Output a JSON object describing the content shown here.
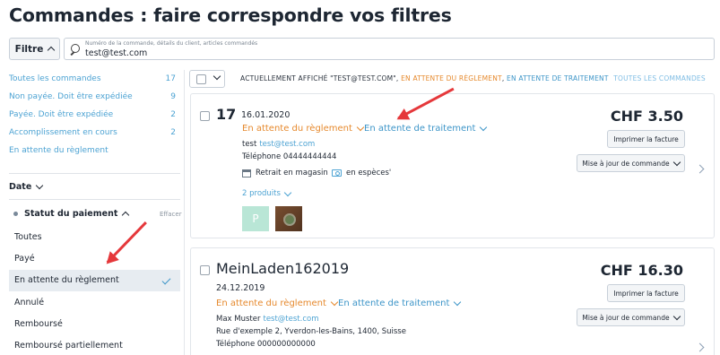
{
  "page": {
    "title": "Commandes : faire correspondre vos filtres"
  },
  "toolbar": {
    "filter_label": "Filtre",
    "search_placeholder": "Numéro de la commande, détails du client, articles commandés",
    "search_value": "test@test.com"
  },
  "sidebar": {
    "items": [
      {
        "label": "Toutes les commandes",
        "count": "17"
      },
      {
        "label": "Non payée. Doit être expédiée",
        "count": "9"
      },
      {
        "label": "Payée. Doit être expédiée",
        "count": "2"
      },
      {
        "label": "Accomplissement en cours",
        "count": "2"
      },
      {
        "label": "En attente du règlement",
        "count": ""
      }
    ],
    "date_label": "Date",
    "payment_status": {
      "label": "Statut du paiement",
      "clear_label": "Effacer",
      "options": [
        {
          "label": "Toutes",
          "selected": false
        },
        {
          "label": "Payé",
          "selected": false
        },
        {
          "label": "En attente du règlement",
          "selected": true
        },
        {
          "label": "Annulé",
          "selected": false
        },
        {
          "label": "Remboursé",
          "selected": false
        },
        {
          "label": "Remboursé partiellement",
          "selected": false
        }
      ]
    }
  },
  "filters_bar": {
    "prefix": "ACTUELLEMENT AFFICHÉ \"TEST@TEST.COM\",",
    "payment": "EN ATTENTE DU RÈGLEMENT",
    "comma": ",",
    "processing": "EN ATTENTE DE TRAITEMENT",
    "all_orders": "TOUTES LES COMMANDES"
  },
  "orders": [
    {
      "number": "17",
      "date": "16.01.2020",
      "payment_status": "En attente du règlement",
      "processing_status": "En attente de traitement",
      "customer_name": "test",
      "customer_email": "test@test.com",
      "phone": "Téléphone 04444444444",
      "shipping": "Retrait en magasin",
      "payment_method": "en espèces'",
      "products_link": "2 produits",
      "thumb_letter": "P",
      "price": "CHF 3.50",
      "print_label": "Imprimer la facture",
      "update_label": "Mise à jour de commande"
    },
    {
      "number": "MeinLaden162019",
      "date": "24.12.2019",
      "payment_status": "En attente du règlement",
      "processing_status": "En attente de traitement",
      "customer_name": "Max Muster",
      "customer_email": "test@test.com",
      "address": "Rue d'exemple 2, Yverdon-les-Bains, 1400, Suisse",
      "phone": "Téléphone 000000000000",
      "price": "CHF 16.30",
      "print_label": "Imprimer la facture",
      "update_label": "Mise à jour de commande"
    }
  ],
  "colors": {
    "accent_blue": "#3d95c8",
    "link_blue": "#4da3d3",
    "pending_orange": "#e6892d",
    "annotation_red": "#e5383b"
  },
  "icons": [
    "search-icon",
    "chevron-up-icon",
    "chevron-down-icon",
    "check-icon",
    "store-icon",
    "cash-icon",
    "chevron-right-icon",
    "annotation-arrow"
  ]
}
